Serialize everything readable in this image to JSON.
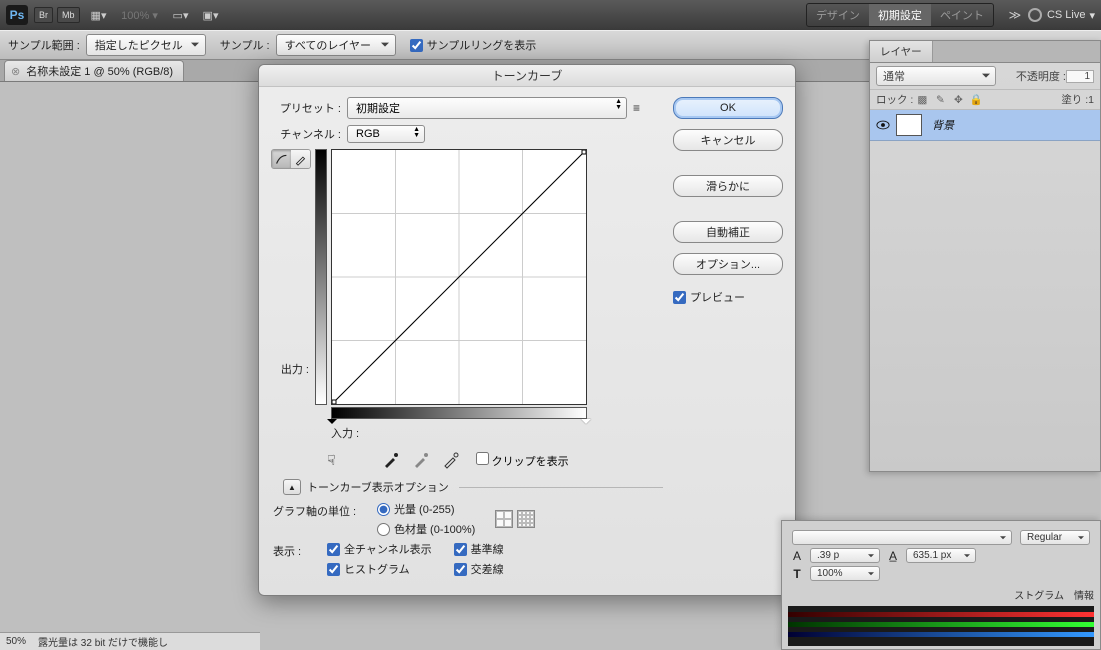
{
  "menubar": {
    "br": "Br",
    "mb": "Mb",
    "workspace_design": "デザイン",
    "workspace_default": "初期設定",
    "workspace_paint": "ペイント",
    "cslive": "CS Live"
  },
  "optbar": {
    "sample_range_label": "サンプル範囲 :",
    "sample_range_value": "指定したピクセル",
    "sample_label": "サンプル :",
    "sample_value": "すべてのレイヤー",
    "show_ring_label": "サンプルリングを表示"
  },
  "doc": {
    "tab_title": "名称未設定 1 @ 50% (RGB/8)"
  },
  "layers": {
    "tab_label": "レイヤー",
    "mode": "通常",
    "opacity_label": "不透明度 :",
    "opacity_value": "1",
    "lock_label": "ロック :",
    "fill_label": "塗り :",
    "fill_value": "1",
    "bg_name": "背景"
  },
  "dialog": {
    "title": "トーンカーブ",
    "preset_label": "プリセット :",
    "preset_value": "初期設定",
    "channel_label": "チャンネル :",
    "channel_value": "RGB",
    "output_label": "出力 :",
    "input_label": "入力 :",
    "show_clip_label": "クリップを表示",
    "disclosure_label": "トーンカーブ表示オプション",
    "axis_label": "グラフ軸の単位  :",
    "axis_opt1": "光量 (0-255)",
    "axis_opt2": "色材量 (0-100%)",
    "show_label": "表示 :",
    "chk_all": "全チャンネル表示",
    "chk_base": "基準線",
    "chk_hist": "ヒストグラム",
    "chk_cross": "交差線",
    "btn_ok": "OK",
    "btn_cancel": "キャンセル",
    "btn_smooth": "滑らかに",
    "btn_auto": "自動補正",
    "btn_options": "オプション...",
    "preview_label": "プレビュー"
  },
  "char": {
    "regular": "Regular",
    "val1": ".39 p",
    "val2": "635.1 px",
    "val3": "100%",
    "tab_hist": "ストグラム",
    "tab_info": "情報"
  },
  "status": {
    "pct": "50%",
    "note": "露光量は 32 bit だけで機能し"
  }
}
